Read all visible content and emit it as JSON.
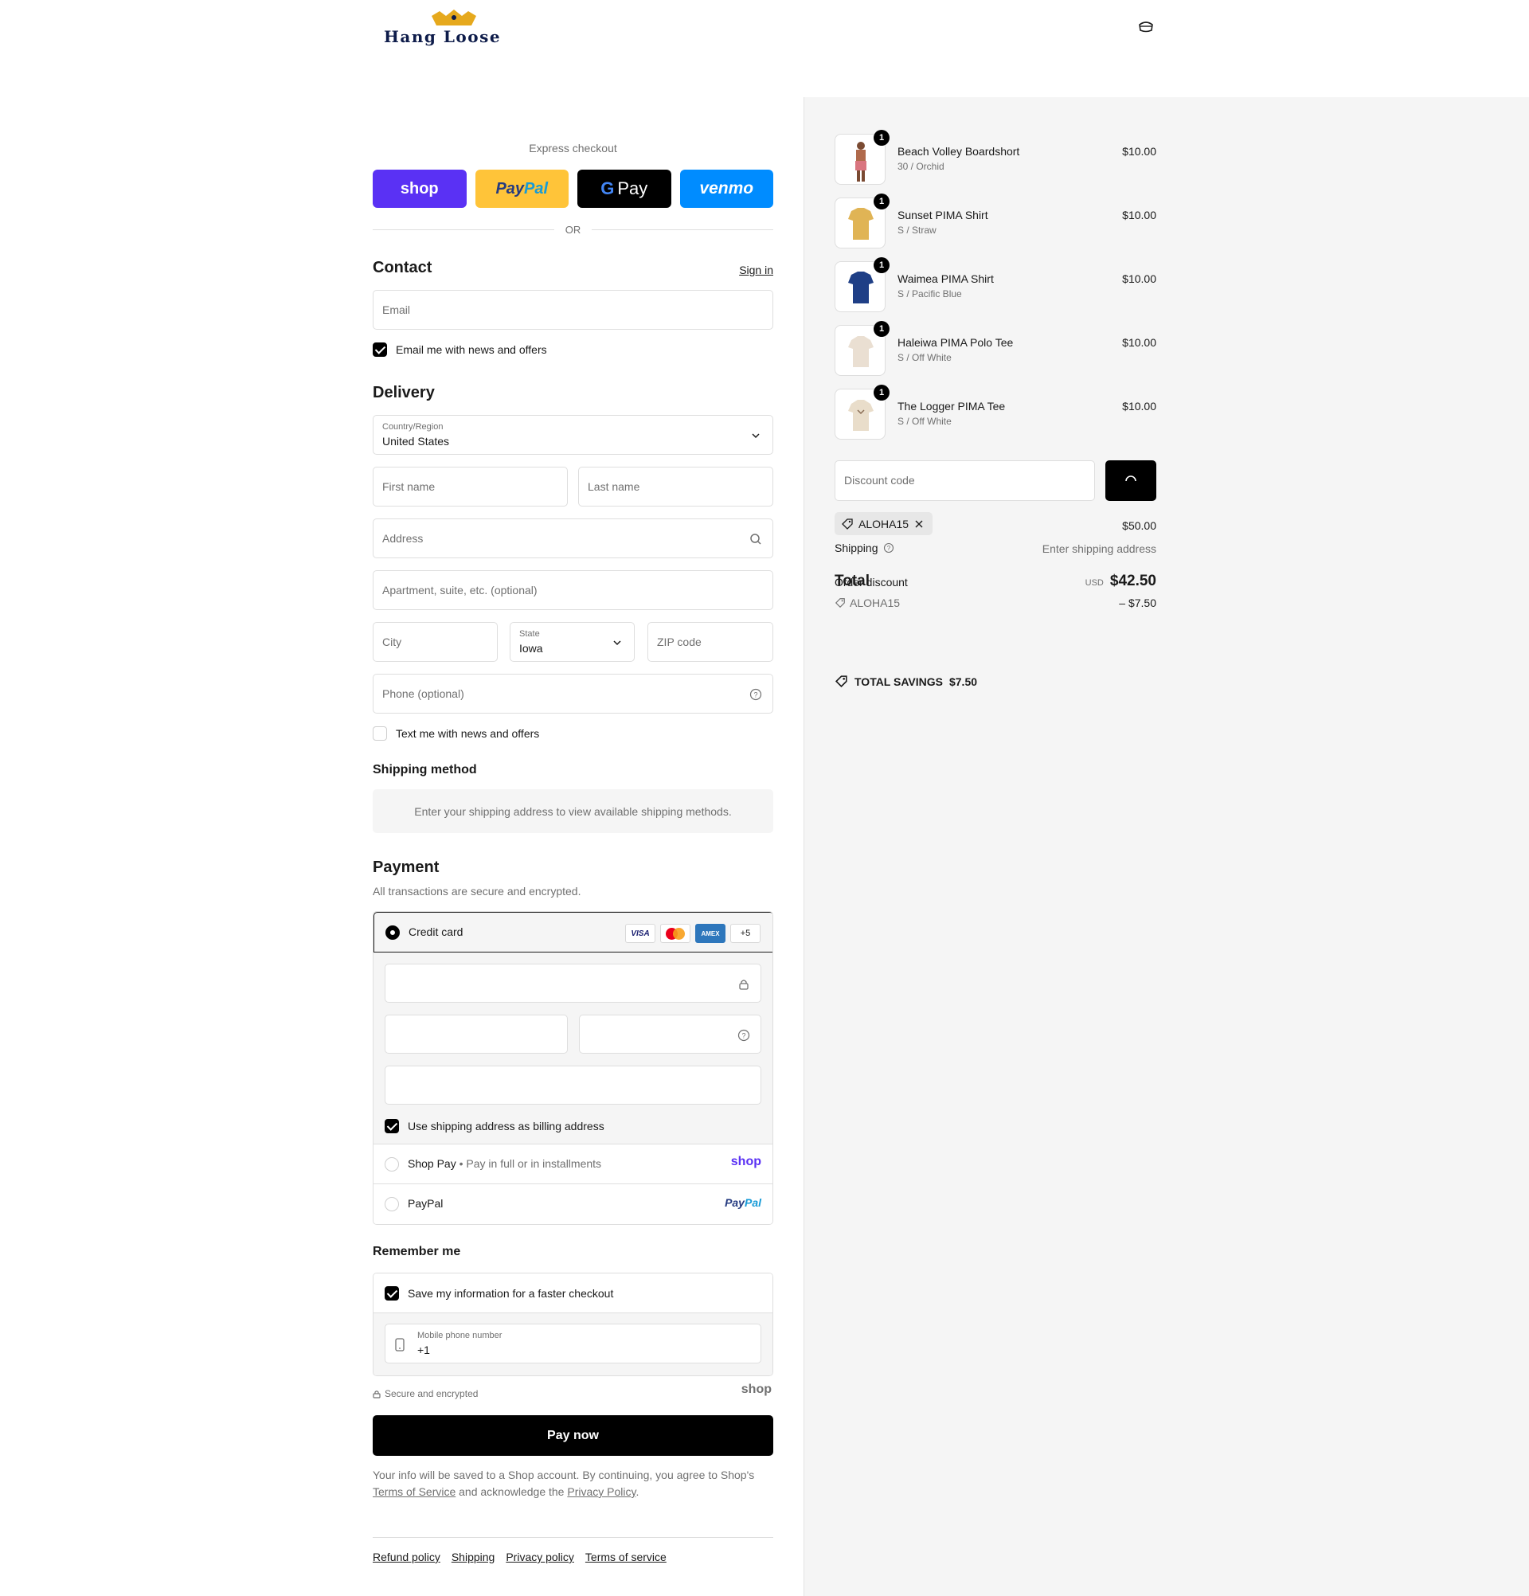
{
  "header": {
    "brand": "Hang Loose"
  },
  "express": {
    "label": "Express checkout",
    "shop": "shop",
    "paypal_a": "Pay",
    "paypal_b": "Pal",
    "gpay": "Pay",
    "venmo": "venmo",
    "or": "OR"
  },
  "contact": {
    "title": "Contact",
    "sign_in": "Sign in",
    "email_placeholder": "Email",
    "news_label": "Email me with news and offers"
  },
  "delivery": {
    "title": "Delivery",
    "country_label": "Country/Region",
    "country_value": "United States",
    "first_name": "First name",
    "last_name": "Last name",
    "address": "Address",
    "apartment": "Apartment, suite, etc. (optional)",
    "city": "City",
    "state_label": "State",
    "state_value": "Iowa",
    "zip": "ZIP code",
    "phone": "Phone (optional)",
    "text_label": "Text me with news and offers"
  },
  "shipping_method": {
    "title": "Shipping method",
    "message": "Enter your shipping address to view available shipping methods."
  },
  "payment": {
    "title": "Payment",
    "subtitle": "All transactions are secure and encrypted.",
    "credit_card": "Credit card",
    "card_logos": [
      "VISA",
      "AMEX",
      "+5"
    ],
    "billing_label": "Use shipping address as billing address",
    "shop_pay": "Shop Pay",
    "shop_pay_sub": "Pay in full or in installments",
    "shop_pay_logo": "shop",
    "paypal": "PayPal",
    "paypal_logo_a": "Pay",
    "paypal_logo_b": "Pal"
  },
  "remember": {
    "title": "Remember me",
    "save_label": "Save my information for a faster checkout",
    "phone_label": "Mobile phone number",
    "phone_value": "+1",
    "secure": "Secure and encrypted",
    "shop_logo": "shop"
  },
  "pay_now": "Pay now",
  "legal": {
    "text_1": "Your info will be saved to a Shop account. By continuing, you agree to Shop's",
    "terms": "Terms of Service",
    "text_2": "and acknowledge the",
    "privacy": "Privacy Policy",
    "end": "."
  },
  "footer": [
    "Refund policy",
    "Shipping",
    "Privacy policy",
    "Terms of service"
  ],
  "summary": {
    "items": [
      {
        "name": "Beach Volley Boardshort",
        "variant": "30 / Orchid",
        "price": "$10.00",
        "qty": "1",
        "color": "#d9757f"
      },
      {
        "name": "Sunset PIMA Shirt",
        "variant": "S / Straw",
        "price": "$10.00",
        "qty": "1",
        "color": "#e0b455"
      },
      {
        "name": "Waimea PIMA Shirt",
        "variant": "S / Pacific Blue",
        "price": "$10.00",
        "qty": "1",
        "color": "#1f3f86"
      },
      {
        "name": "Haleiwa PIMA Polo Tee",
        "variant": "S / Off White",
        "price": "$10.00",
        "qty": "1",
        "color": "#eadfd2"
      },
      {
        "name": "The Logger PIMA Tee",
        "variant": "S / Off White",
        "price": "$10.00",
        "qty": "1",
        "color": "#e9ddca"
      }
    ],
    "discount_placeholder": "Discount code",
    "applied_code": "ALOHA15",
    "subtotal_value": "$50.00",
    "shipping_label": "Shipping",
    "shipping_value": "Enter shipping address",
    "total_label": "Total",
    "order_discount_label": "Order discount",
    "currency": "USD",
    "total_value": "$42.50",
    "discount_code": "ALOHA15",
    "discount_value": "– $7.50",
    "savings_label": "TOTAL SAVINGS",
    "savings_value": "$7.50"
  }
}
